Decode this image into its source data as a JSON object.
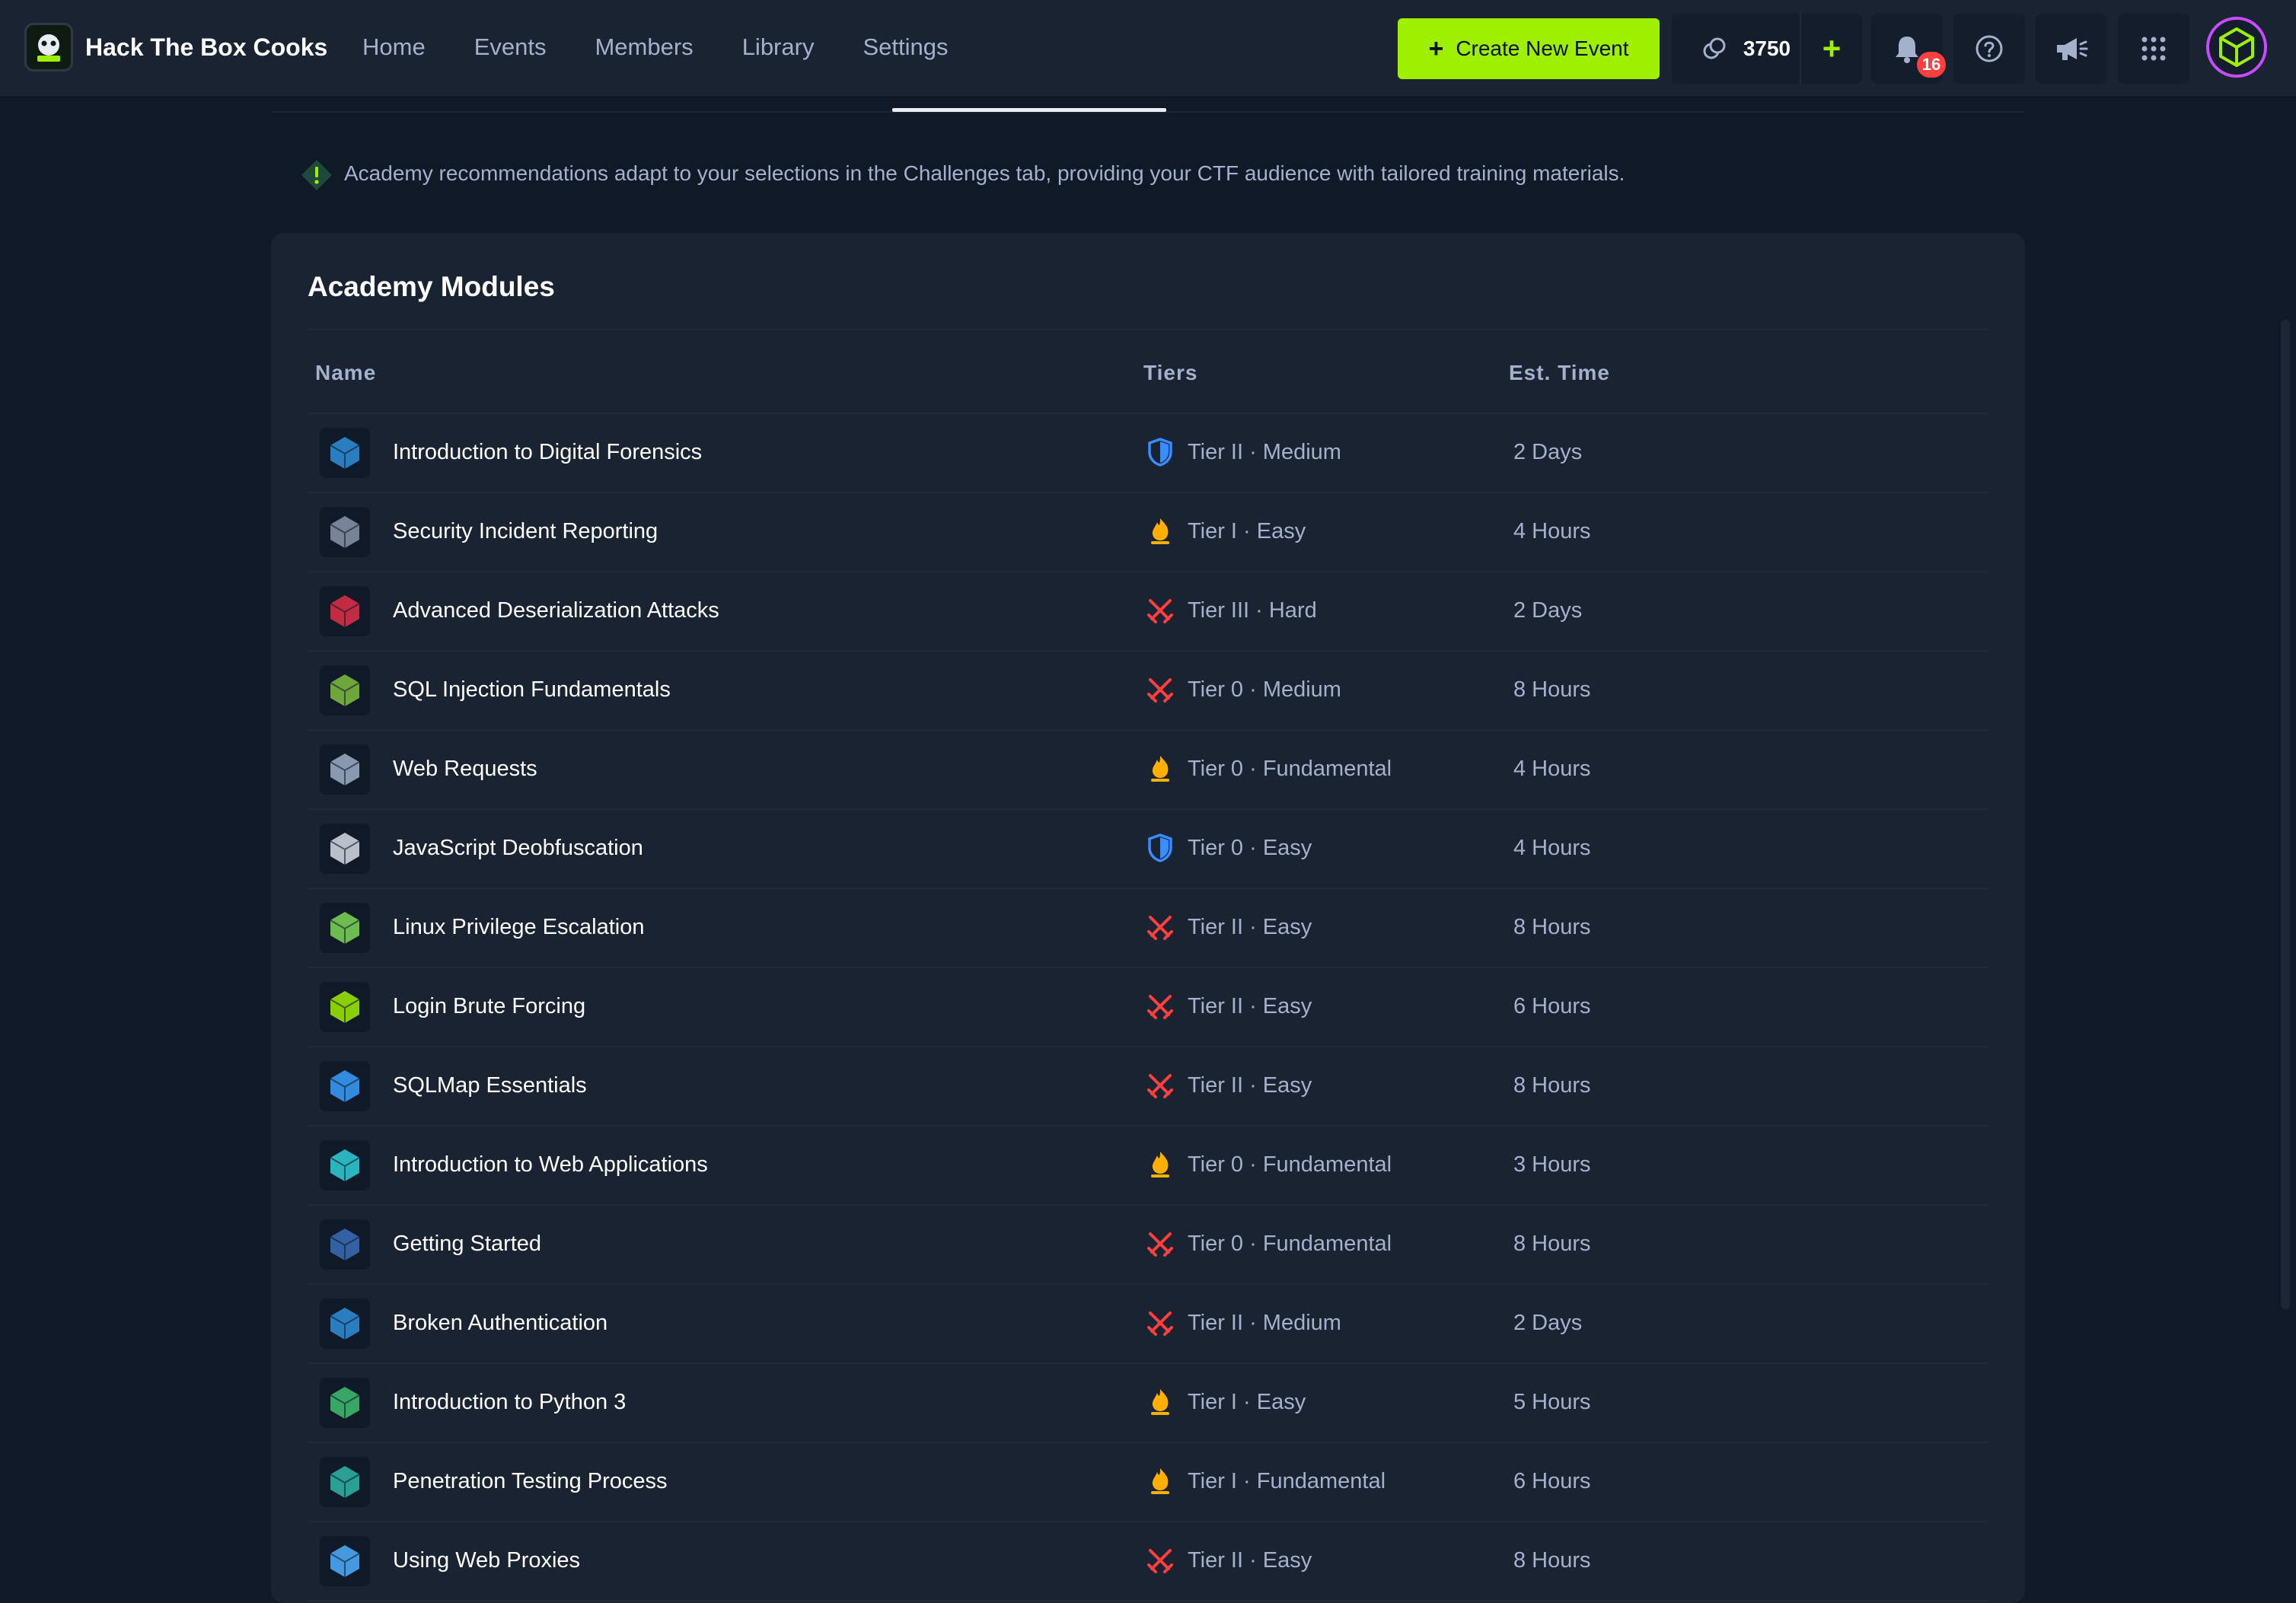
{
  "header": {
    "brand": "Hack The Box Cooks",
    "nav": [
      "Home",
      "Events",
      "Members",
      "Library",
      "Settings"
    ],
    "create_label": "Create New Event",
    "create_plus": "+",
    "credits": "3750",
    "credits_add": "+",
    "notifications_count": "16"
  },
  "info": {
    "text": "Academy recommendations adapt to your selections in the Challenges tab, providing your CTF audience with tailored training materials."
  },
  "panel": {
    "title": "Academy Modules",
    "columns": {
      "name": "Name",
      "tiers": "Tiers",
      "time": "Est. Time"
    }
  },
  "modules": [
    {
      "name": "Introduction to Digital Forensics",
      "tier": "Tier II · Medium",
      "tier_icon": "shield",
      "time": "2 Days",
      "thumb": "#2f8fd8"
    },
    {
      "name": "Security Incident Reporting",
      "tier": "Tier I · Easy",
      "tier_icon": "flame",
      "time": "4 Hours",
      "thumb": "#8a96aa"
    },
    {
      "name": "Advanced Deserialization Attacks",
      "tier": "Tier III · Hard",
      "tier_icon": "swords",
      "time": "2 Days",
      "thumb": "#e03048"
    },
    {
      "name": "SQL Injection Fundamentals",
      "tier": "Tier 0 · Medium",
      "tier_icon": "swords",
      "time": "8 Hours",
      "thumb": "#7fbf3f"
    },
    {
      "name": "Web Requests",
      "tier": "Tier 0 · Fundamental",
      "tier_icon": "flame",
      "time": "4 Hours",
      "thumb": "#9fb2c8"
    },
    {
      "name": "JavaScript Deobfuscation",
      "tier": "Tier 0 · Easy",
      "tier_icon": "shield",
      "time": "4 Hours",
      "thumb": "#d8dde6"
    },
    {
      "name": "Linux Privilege Escalation",
      "tier": "Tier II · Easy",
      "tier_icon": "swords",
      "time": "8 Hours",
      "thumb": "#7ed957"
    },
    {
      "name": "Login Brute Forcing",
      "tier": "Tier II · Easy",
      "tier_icon": "swords",
      "time": "6 Hours",
      "thumb": "#9fef00"
    },
    {
      "name": "SQLMap Essentials",
      "tier": "Tier II · Easy",
      "tier_icon": "swords",
      "time": "8 Hours",
      "thumb": "#3aa0ff"
    },
    {
      "name": "Introduction to Web Applications",
      "tier": "Tier 0 · Fundamental",
      "tier_icon": "flame",
      "time": "3 Hours",
      "thumb": "#2fd0d8"
    },
    {
      "name": "Getting Started",
      "tier": "Tier 0 · Fundamental",
      "tier_icon": "swords",
      "time": "8 Hours",
      "thumb": "#3a6fb8"
    },
    {
      "name": "Broken Authentication",
      "tier": "Tier II · Medium",
      "tier_icon": "swords",
      "time": "2 Days",
      "thumb": "#2f8fd8"
    },
    {
      "name": "Introduction to Python 3",
      "tier": "Tier I · Easy",
      "tier_icon": "flame",
      "time": "5 Hours",
      "thumb": "#3fbf6f"
    },
    {
      "name": "Penetration Testing Process",
      "tier": "Tier I · Fundamental",
      "tier_icon": "flame",
      "time": "6 Hours",
      "thumb": "#2fb8a8"
    },
    {
      "name": "Using Web Proxies",
      "tier": "Tier II · Easy",
      "tier_icon": "swords",
      "time": "8 Hours",
      "thumb": "#4fb0ff"
    }
  ],
  "colors": {
    "accent": "#9fef00",
    "shield": "#3b8cff",
    "flame": "#ffaf00",
    "swords": "#ff3e3e",
    "badge": "#ff3e3e"
  }
}
